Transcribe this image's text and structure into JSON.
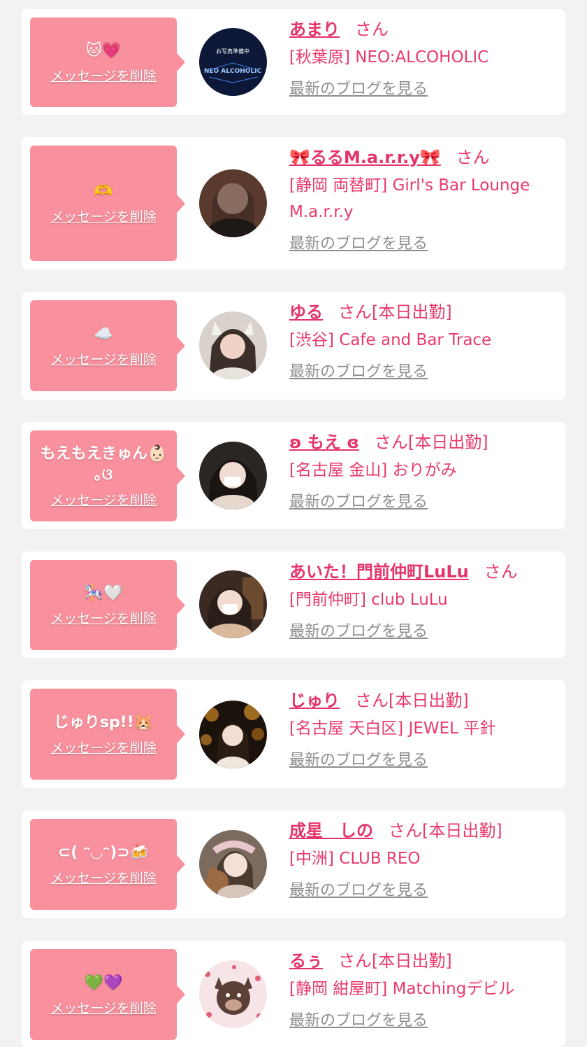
{
  "delete_label": "メッセージを削除",
  "blog_label": "最新のブログを見る",
  "san_label": "さん",
  "colors": {
    "bubble": "#f8909d",
    "accent": "#e4346a",
    "link_gray": "#8e8e8e",
    "background": "#f2f2f2"
  },
  "entries": [
    {
      "message": "🐱💗",
      "name": "あまり",
      "status": "",
      "shop": "[秋葉原] NEO:ALCOHOLIC",
      "avatar_caption": "お写真準備中",
      "avatar_logo": "NEO ALCOHOLIC"
    },
    {
      "message": "🫶",
      "name": "🎀るるM.a.r.r.y🎀",
      "status": "",
      "shop": "[静岡 両替町] Girl's Bar Lounge M.a.r.r.y"
    },
    {
      "message": "☁️",
      "name": "ゆる",
      "status": "[本日出勤]",
      "shop": "[渋谷] Cafe and Bar Trace"
    },
    {
      "message": "もえもえきゅん👶🏻 ｡ଓ",
      "name": "ʚ もえ ɞ",
      "status": "[本日出勤]",
      "shop": "[名古屋 金山] おりがみ"
    },
    {
      "message": "🎠🤍",
      "name": "あいた！門前仲町LuLu",
      "status": "",
      "shop": "[門前仲町] club LuLu"
    },
    {
      "message": "じゅりsp!!🐹",
      "name": "じゅり",
      "status": "[本日出勤]",
      "shop": "[名古屋 天白区] JEWEL 平針"
    },
    {
      "message": "⊂( ᵔ◡ᵔ)⊃🍻",
      "name": "成星　しの",
      "status": "[本日出勤]",
      "shop": "[中洲] CLUB REO"
    },
    {
      "message": "💚💜",
      "name": "るぅ",
      "status": "[本日出勤]",
      "shop": "[静岡 紺屋町] Matchingデビル"
    }
  ]
}
